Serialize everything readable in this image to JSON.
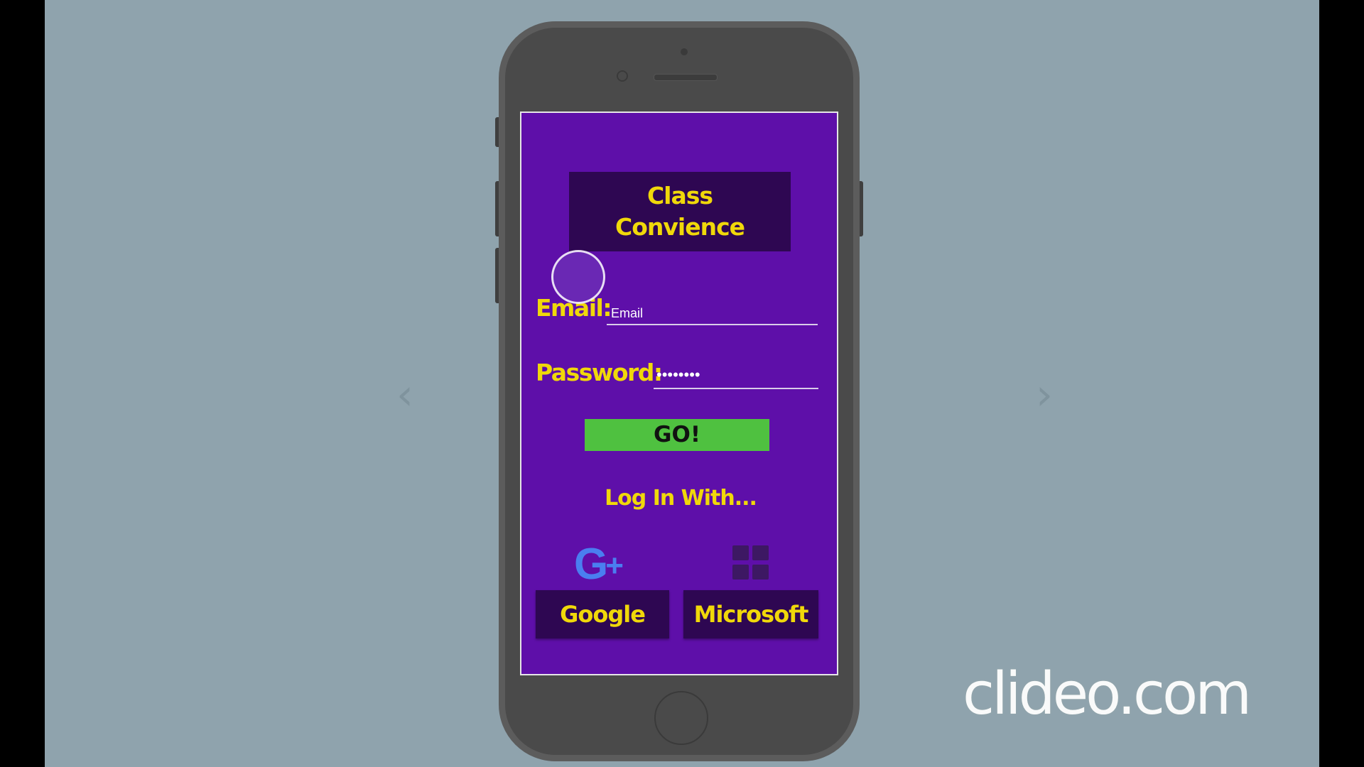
{
  "app": {
    "title": "Class\nConvience"
  },
  "form": {
    "email_label": "Email:",
    "email_value": "Email",
    "password_label": "Password:",
    "password_value": "••••••••",
    "go_label": "GO!"
  },
  "social": {
    "heading": "Log In With...",
    "google_logo_text": "G",
    "google_logo_plus": "+",
    "google_label": "Google",
    "microsoft_label": "Microsoft"
  },
  "viewer": {
    "prev_arrow": "‹",
    "next_arrow": "›",
    "watermark": "clideo.com"
  },
  "colors": {
    "screen_bg": "#5e0fa9",
    "panel_bg": "#2e0752",
    "text_yellow": "#f0d80a",
    "go_green": "#4fc140",
    "google_blue": "#4a7ef0",
    "stage_bg": "#8fa3ad"
  },
  "icons": [
    "google-plus-icon",
    "microsoft-grid-icon",
    "chevron-left-icon",
    "chevron-right-icon"
  ]
}
